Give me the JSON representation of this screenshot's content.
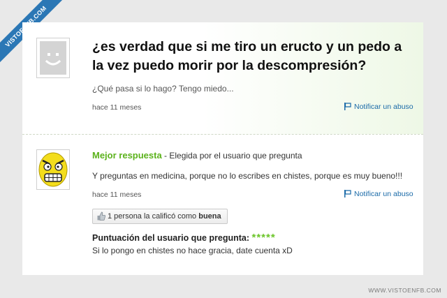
{
  "watermark": {
    "ribbon": "VISTOENFB.COM",
    "footer": "WWW.VISTOENFB.COM"
  },
  "question": {
    "title": "¿es verdad que si me tiro un eructo y un pedo a la vez puedo morir por la descompresión?",
    "details": "¿Qué pasa si lo hago? Tengo miedo...",
    "time": "hace 11 meses",
    "report_label": "Notificar un abuso"
  },
  "best_answer": {
    "label": "Mejor respuesta",
    "chosen_by": " - Elegida por el usuario que pregunta",
    "text": "Y preguntas en medicina, porque no lo escribes en chistes, porque es muy bueno!!!",
    "time": "hace 11 meses",
    "report_label": "Notificar un abuso",
    "rating_text": "1 persona la calificó como ",
    "rating_value": "buena",
    "asker_score_label": "Puntuación del usuario que pregunta:",
    "asker_stars": "*****",
    "asker_comment": "Si lo pongo en chistes no hace gracia, date cuenta xD"
  },
  "colors": {
    "accent_green": "#5bb21b",
    "link_blue": "#1a6aa8",
    "ribbon_blue": "#2b77b5"
  },
  "icons": [
    "default-avatar-icon",
    "rage-face-avatar",
    "flag-icon",
    "thumbs-up-icon"
  ]
}
